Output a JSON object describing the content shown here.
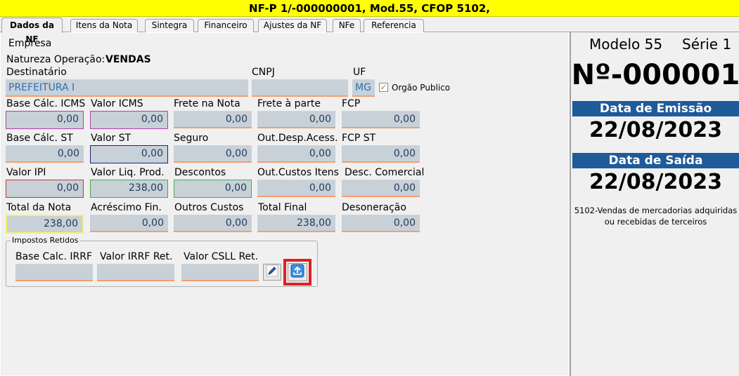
{
  "window": {
    "title": "NF-P 1/-000000001, Mod.55, CFOP 5102,"
  },
  "tabs": [
    {
      "label": "Dados da NF"
    },
    {
      "label": "Itens da Nota"
    },
    {
      "label": "Sintegra"
    },
    {
      "label": "Financeiro"
    },
    {
      "label": "Ajustes da NF"
    },
    {
      "label": "NFe"
    },
    {
      "label": "Referencia"
    }
  ],
  "form": {
    "empresa_label": "Empresa",
    "natureza_label": "Natureza Operação:",
    "natureza_value": "VENDAS",
    "destinatario_label": "Destinatário",
    "destinatario_value": "PREFEITURA I",
    "cnpj_label": "CNPJ",
    "cnpj_value": "",
    "uf_label": "UF",
    "uf_value": "MG",
    "orgao_label": "Orgão Publico",
    "orgao_checked": "✓",
    "row1": {
      "base_icms_label": "Base Cálc. ICMS",
      "base_icms": "0,00",
      "valor_icms_label": "Valor ICMS",
      "valor_icms": "0,00",
      "frete_nota_label": "Frete na Nota",
      "frete_nota": "0,00",
      "frete_parte_label": "Frete à parte",
      "frete_parte": "0,00",
      "fcp_label": "FCP",
      "fcp": "0,00"
    },
    "row2": {
      "base_st_label": "Base Cálc. ST",
      "base_st": "0,00",
      "valor_st_label": "Valor ST",
      "valor_st": "0,00",
      "seguro_label": "Seguro",
      "seguro": "0,00",
      "out_desp_label": "Out.Desp.Acess.",
      "out_desp": "0,00",
      "fcp_st_label": "FCP ST",
      "fcp_st": "0,00"
    },
    "row3": {
      "valor_ipi_label": "Valor IPI",
      "valor_ipi": "0,00",
      "valor_liq_label": "Valor Liq. Prod.",
      "valor_liq": "238,00",
      "descontos_label": "Descontos",
      "descontos": "0,00",
      "out_custos_label": "Out.Custos Itens",
      "out_custos": "0,00",
      "desc_comercial_label": "Desc. Comercial",
      "desc_comercial": "0,00"
    },
    "row4": {
      "total_nota_label": "Total da Nota",
      "total_nota": "238,00",
      "acrescimo_label": "Acréscimo Fin.",
      "acrescimo": "0,00",
      "outros_custos_label": "Outros Custos",
      "outros_custos": "0,00",
      "total_final_label": "Total Final",
      "total_final": "238,00",
      "desoneracao_label": "Desoneração",
      "desoneracao": "0,00"
    },
    "impostos": {
      "title": "Impostos Retidos",
      "base_irrf_label": "Base Calc. IRRF",
      "base_irrf": "",
      "valor_irrf_label": "Valor IRRF Ret.",
      "valor_irrf": "",
      "valor_csll_label": "Valor CSLL Ret.",
      "valor_csll": ""
    }
  },
  "summary": {
    "modelo": "Modelo 55",
    "serie": "Série 1",
    "numero": "Nº-000001",
    "emissao_label": "Data de Emissão",
    "emissao": "22/08/2023",
    "saida_label": "Data de Saída",
    "saida": "22/08/2023",
    "cfop_desc": "5102-Vendas de mercadorias adquiridas ou recebidas de terceiros"
  },
  "icons": {
    "edit": "pencil-icon",
    "upload": "upload-icon"
  },
  "colors": {
    "title_bg": "#ffff00",
    "banner": "#1f5a9a",
    "highlight": "#e02020"
  }
}
